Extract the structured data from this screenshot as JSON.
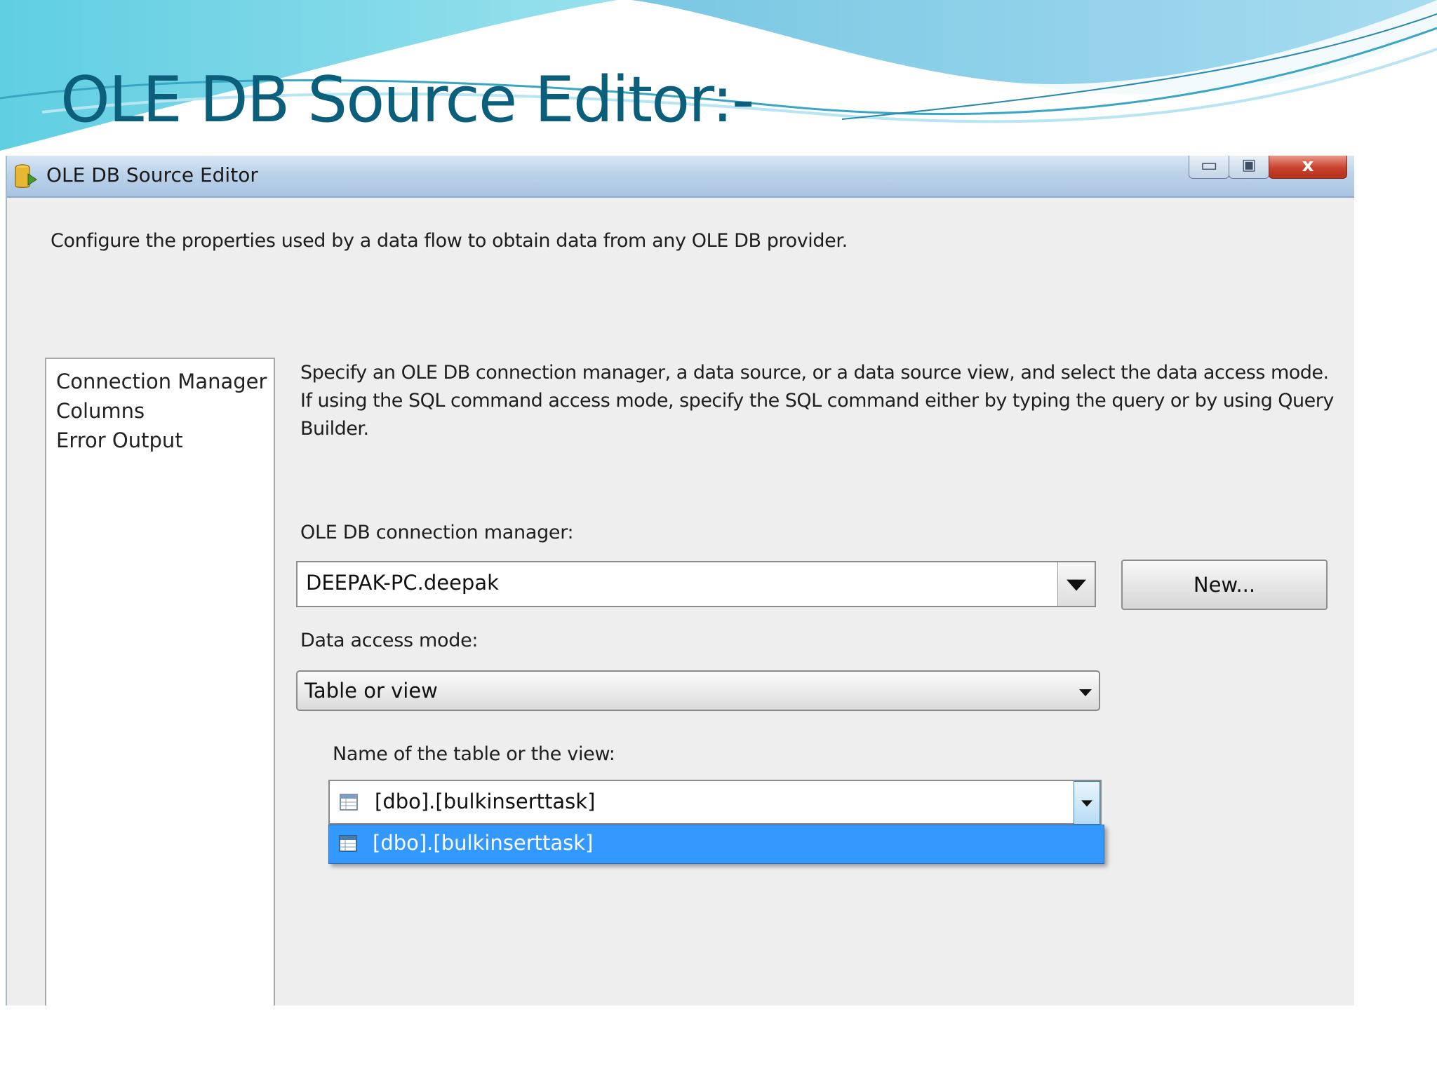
{
  "slide": {
    "title": "OLE DB Source Editor:-"
  },
  "window": {
    "title": "OLE DB Source Editor",
    "close_glyph": "x",
    "maximize_glyph": "▣",
    "minimize_glyph": "▭",
    "description": "Configure the properties used by a data flow to obtain data from any OLE DB provider."
  },
  "nav": {
    "items": [
      {
        "label": "Connection Manager"
      },
      {
        "label": "Columns"
      },
      {
        "label": "Error Output"
      }
    ]
  },
  "content": {
    "description": "Specify an OLE DB connection manager, a data source, or a data source view, and select the data access mode. If using the SQL command access mode, specify the SQL command either by typing the query or by using Query Builder.",
    "connection_label": "OLE DB connection manager:",
    "connection_value": "DEEPAK-PC.deepak",
    "new_button": "New...",
    "access_mode_label": "Data access mode:",
    "access_mode_value": "Table or view",
    "table_name_label": "Name of the table or the view:",
    "table_name_value": "[dbo].[bulkinserttask]",
    "table_options": [
      {
        "label": "[dbo].[bulkinserttask]",
        "selected": true
      }
    ]
  },
  "colors": {
    "title_text": "#0c5f7a",
    "selection": "#3399ff",
    "dialog_background": "#eeeeee"
  }
}
